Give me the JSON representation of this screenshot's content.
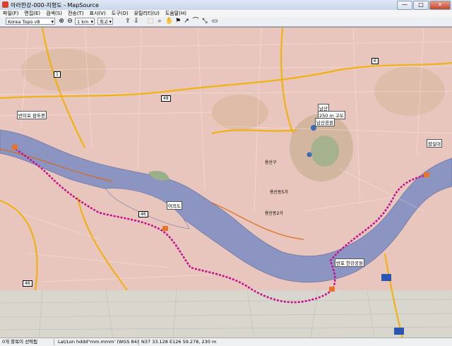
{
  "window": {
    "title": "아라한강-000-지형도 - MapSource",
    "minimize": "—",
    "maximize": "□",
    "close": "✕"
  },
  "menu": [
    "파일(F)",
    "편집(E)",
    "검색(S)",
    "전송(T)",
    "표시(V)",
    "도구(O)",
    "유틸리티(U)",
    "도움말(H)"
  ],
  "toolbar": {
    "map_product": "Korea Topo v8",
    "scale": "1 km",
    "detail": "최고",
    "icons": [
      "zoom-in-icon",
      "zoom-out-icon",
      "gps-send-icon",
      "gps-receive-icon",
      "select-icon",
      "zoom-tool-icon",
      "hand-tool-icon",
      "waypoint-tool-icon",
      "route-tool-icon",
      "track-tool-icon",
      "measure-tool-icon",
      "pointer-icon",
      "ruler-icon"
    ]
  },
  "map": {
    "labels": {
      "waypoint_west": "반미포 잠두봉",
      "waypoint_yeouido": "여의도",
      "waypoint_east": "반포 한강공원",
      "waypoint_far_east": "잠실대",
      "namsan": "남산",
      "namsan_elev": "250 m 고도",
      "namsan_park": "남산공원",
      "district_1": "용산구",
      "district_2": "용산동2가",
      "district_3": "용산동5가"
    },
    "shields": {
      "r1": "1",
      "r6": "6",
      "r48": "48",
      "r46a": "46",
      "r46b": "46"
    },
    "colors": {
      "water": "#8c95c2",
      "urban": "#e9c6bd",
      "route": "#c8108e",
      "road_major": "#f0b000",
      "park": "#9bb08a"
    }
  },
  "status": {
    "hint": "0개 항목이 선택됨",
    "position_format": "Lat/Lon hddd°mm.mmm' (WGS 84)",
    "position": "N37 33.128 E126 59.278, 230 m"
  }
}
